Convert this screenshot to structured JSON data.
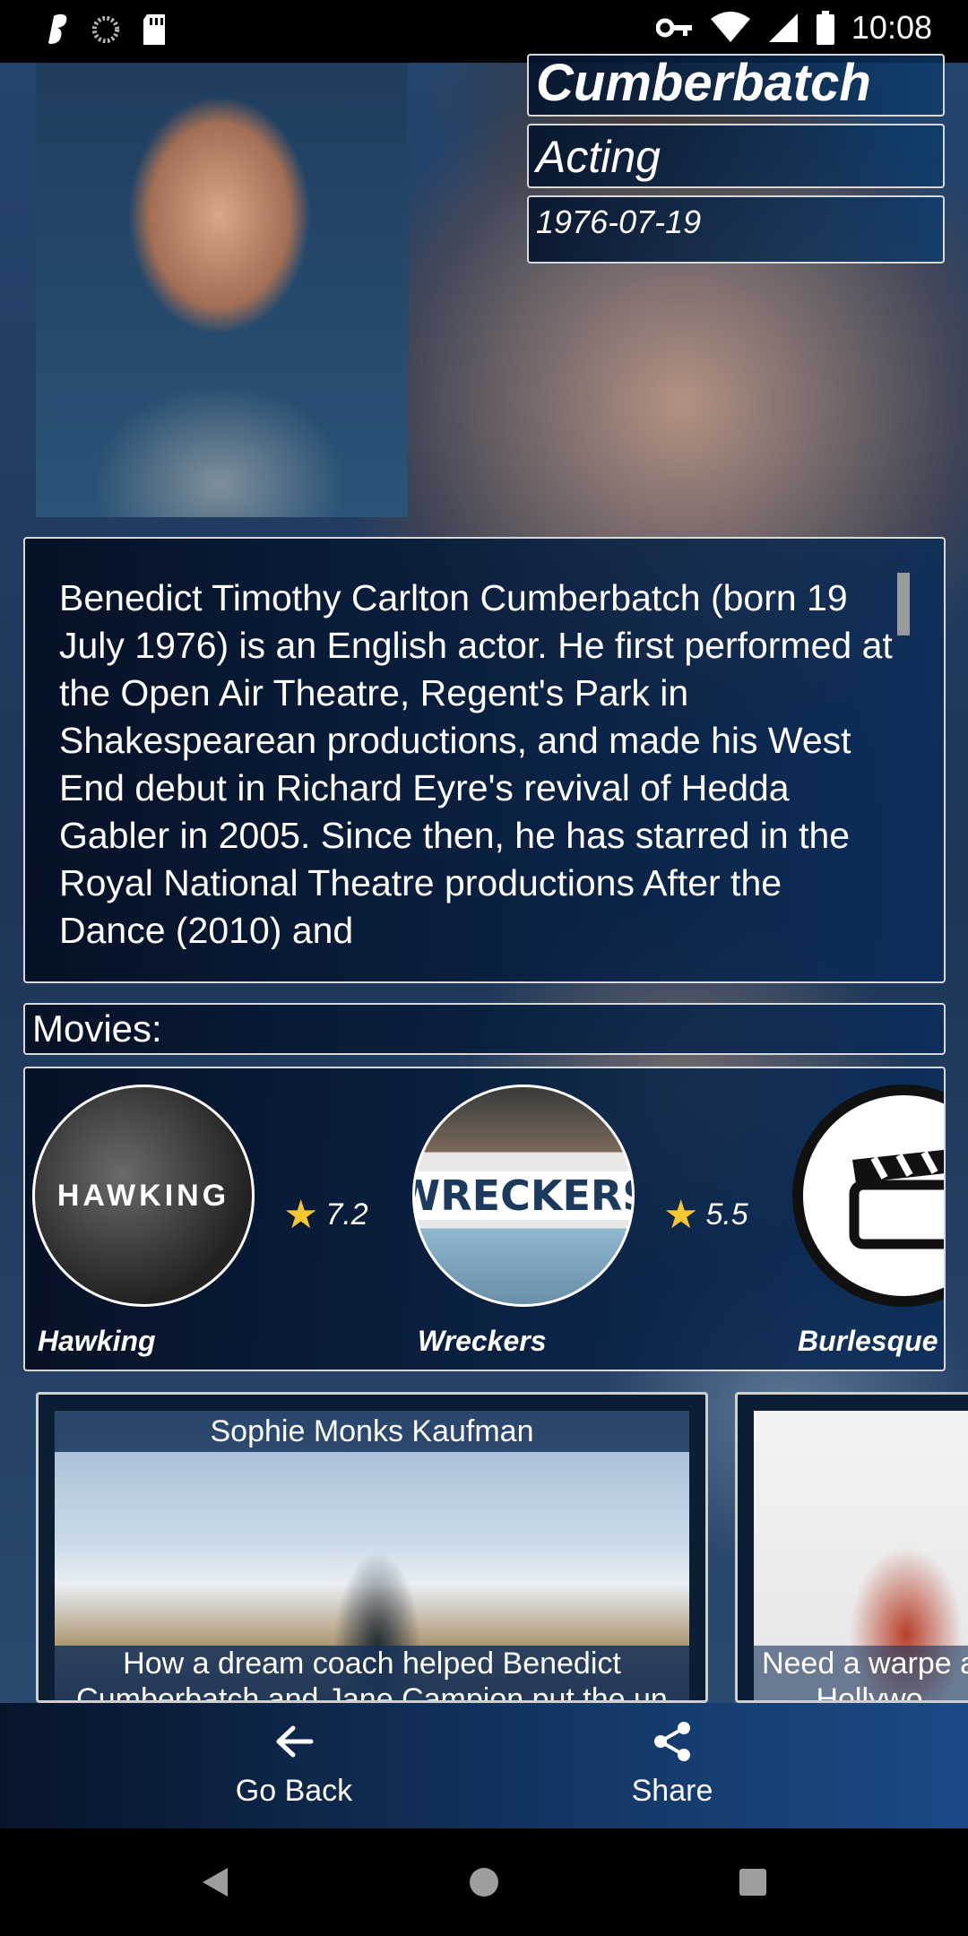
{
  "status_bar": {
    "time": "10:08",
    "icons": [
      "app-s-icon",
      "loading-icon",
      "sd-card-icon",
      "vpn-key-icon",
      "wifi-icon",
      "signal-icon",
      "battery-icon"
    ]
  },
  "person": {
    "name": "Cumberbatch",
    "department": "Acting",
    "birthday": "1976-07-19",
    "biography": "Benedict Timothy Carlton Cumberbatch (born 19 July 1976) is an English actor. He first performed at the Open Air Theatre, Regent's Park in Shakespearean productions, and made his West End debut in Richard Eyre's revival of Hedda Gabler in 2005. Since then, he has starred in the Royal National Theatre productions After the Dance (2010) and"
  },
  "movies": {
    "label": "Movies:",
    "items": [
      {
        "title": "Hawking",
        "poster_text": "HAWKING",
        "rating": "7.2"
      },
      {
        "title": "Wreckers",
        "poster_text": "WRECKERS",
        "rating": "5.5"
      },
      {
        "title": "Burlesque I",
        "poster_text": "",
        "rating": ""
      }
    ]
  },
  "news": [
    {
      "author": "Sophie Monks Kaufman",
      "headline": "How a dream coach helped Benedict Cumberbatch and Jane Campion put the un"
    },
    {
      "author": "",
      "headline": "Need a warpe a Hollywo"
    }
  ],
  "actions": {
    "go_back": "Go Back",
    "share": "Share"
  },
  "colors": {
    "star": "#f8c72f",
    "panel_dark": "#05142d",
    "panel_blue": "#0a3c6e"
  }
}
